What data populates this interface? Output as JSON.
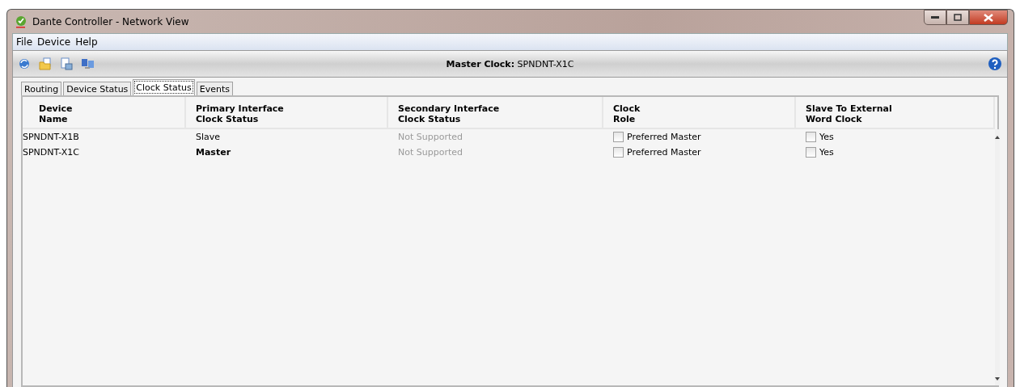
{
  "window": {
    "title": "Dante Controller - Network View"
  },
  "menu": [
    "File",
    "Device",
    "Help"
  ],
  "toolbar": {
    "status_label": "Master Clock:",
    "status_value": "SPNDNT-X1C"
  },
  "tabs": [
    {
      "label": "Routing",
      "selected": false
    },
    {
      "label": "Device Status",
      "selected": false
    },
    {
      "label": "Clock Status",
      "selected": true
    },
    {
      "label": "Events",
      "selected": false
    }
  ],
  "table": {
    "columns": [
      [
        "Device",
        "Name"
      ],
      [
        "Primary Interface",
        "Clock Status"
      ],
      [
        "Secondary Interface",
        "Clock Status"
      ],
      [
        "Clock",
        "Role"
      ],
      [
        "Slave To External",
        "Word Clock"
      ]
    ],
    "rows": [
      {
        "device": "SPNDNT-X1B",
        "primary": "Slave",
        "primary_emphasized": false,
        "secondary": "Not Supported",
        "role": "Preferred Master",
        "role_checked": false,
        "external": "Yes",
        "external_checked": false
      },
      {
        "device": "SPNDNT-X1C",
        "primary": "Master",
        "primary_emphasized": true,
        "secondary": "Not Supported",
        "role": "Preferred Master",
        "role_checked": false,
        "external": "Yes",
        "external_checked": false
      }
    ]
  }
}
